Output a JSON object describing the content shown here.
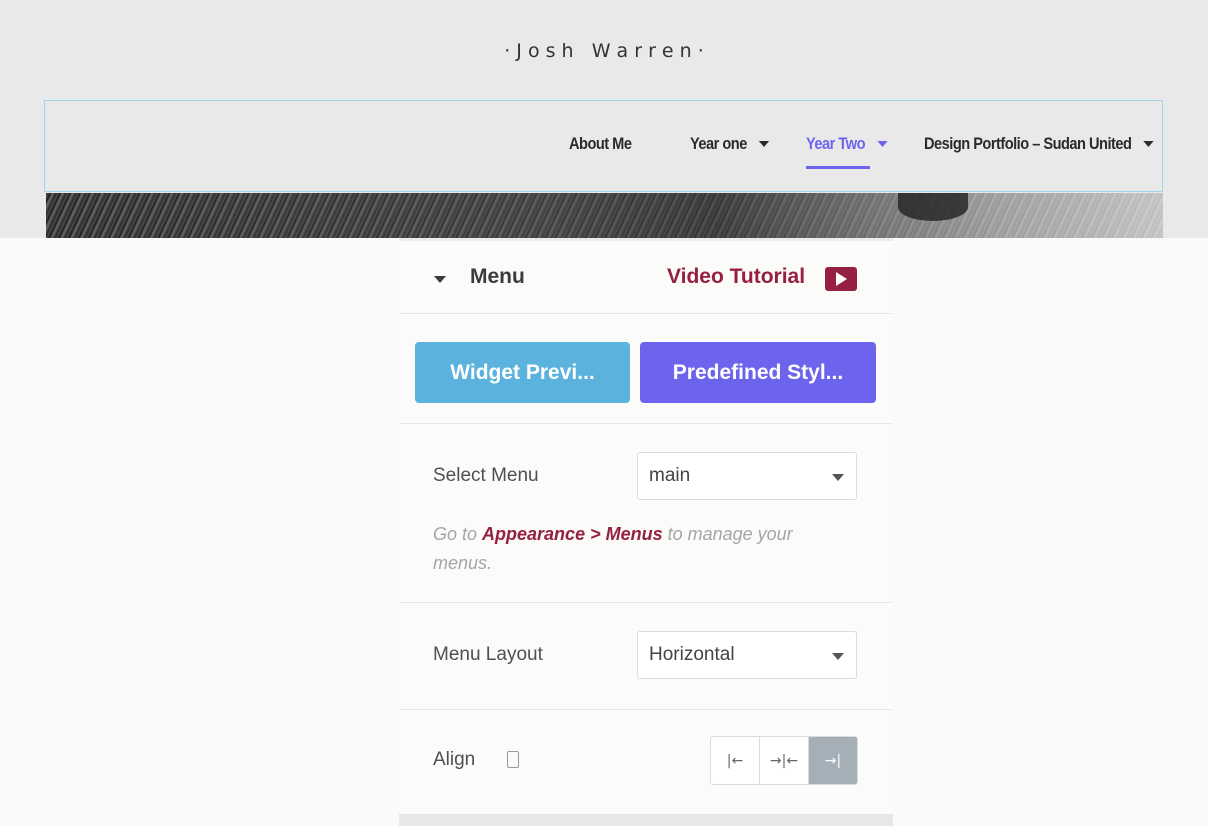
{
  "site": {
    "title": "· J o s h   W a r r e n ·",
    "nav": [
      {
        "label": "About Me",
        "has_dropdown": false,
        "active": false
      },
      {
        "label": "Year one",
        "has_dropdown": true,
        "active": false
      },
      {
        "label": "Year Two",
        "has_dropdown": true,
        "active": true
      },
      {
        "label": "Design Portfolio – Sudan United",
        "has_dropdown": true,
        "active": false
      }
    ]
  },
  "panel": {
    "section_title": "Menu",
    "video_tutorial": "Video Tutorial",
    "widget_preview_button": "Widget Previ...",
    "predefined_styles_button": "Predefined Styl...",
    "select_menu": {
      "label": "Select Menu",
      "value": "main"
    },
    "help": {
      "prefix": "Go to ",
      "link": "Appearance > Menus",
      "suffix": " to manage your menus."
    },
    "menu_layout": {
      "label": "Menu Layout",
      "value": "Horizontal"
    },
    "align": {
      "label": "Align",
      "options": [
        "left",
        "center",
        "right"
      ],
      "selected": "right"
    },
    "icons": {
      "head_caret": "caret-down-icon",
      "video": "video-play-icon",
      "device": "mobile-device-icon"
    }
  },
  "colors": {
    "accent": "#6d64ee",
    "link": "#962042",
    "preview_button": "#5bb3dd",
    "nav_text": "#2b2b2b"
  }
}
